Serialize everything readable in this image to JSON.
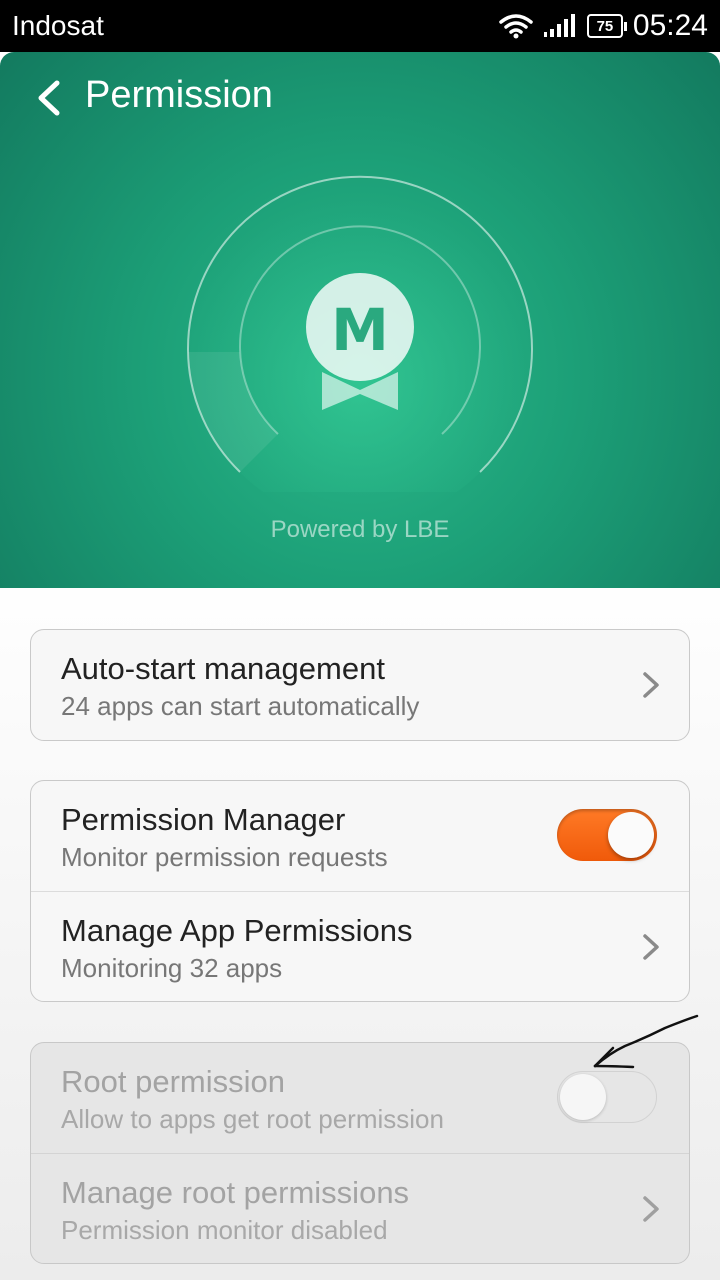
{
  "statusbar": {
    "carrier": "Indosat",
    "battery": "75",
    "time": "05:24"
  },
  "header": {
    "title": "Permission",
    "logo_letter": "M",
    "powered_by": "Powered by LBE",
    "accent_color": "#1c9f77"
  },
  "autostart": {
    "title": "Auto-start management",
    "subtitle": "24 apps can start automatically"
  },
  "permission_manager": {
    "title": "Permission Manager",
    "subtitle": "Monitor permission requests",
    "enabled": true
  },
  "manage_app_permissions": {
    "title": "Manage App Permissions",
    "subtitle": "Monitoring 32 apps"
  },
  "root_permission": {
    "title": "Root permission",
    "subtitle": "Allow to apps get root permission",
    "enabled": false
  },
  "manage_root_permissions": {
    "title": "Manage root permissions",
    "subtitle": "Permission monitor disabled"
  },
  "toggle_on_color": "#f26512"
}
